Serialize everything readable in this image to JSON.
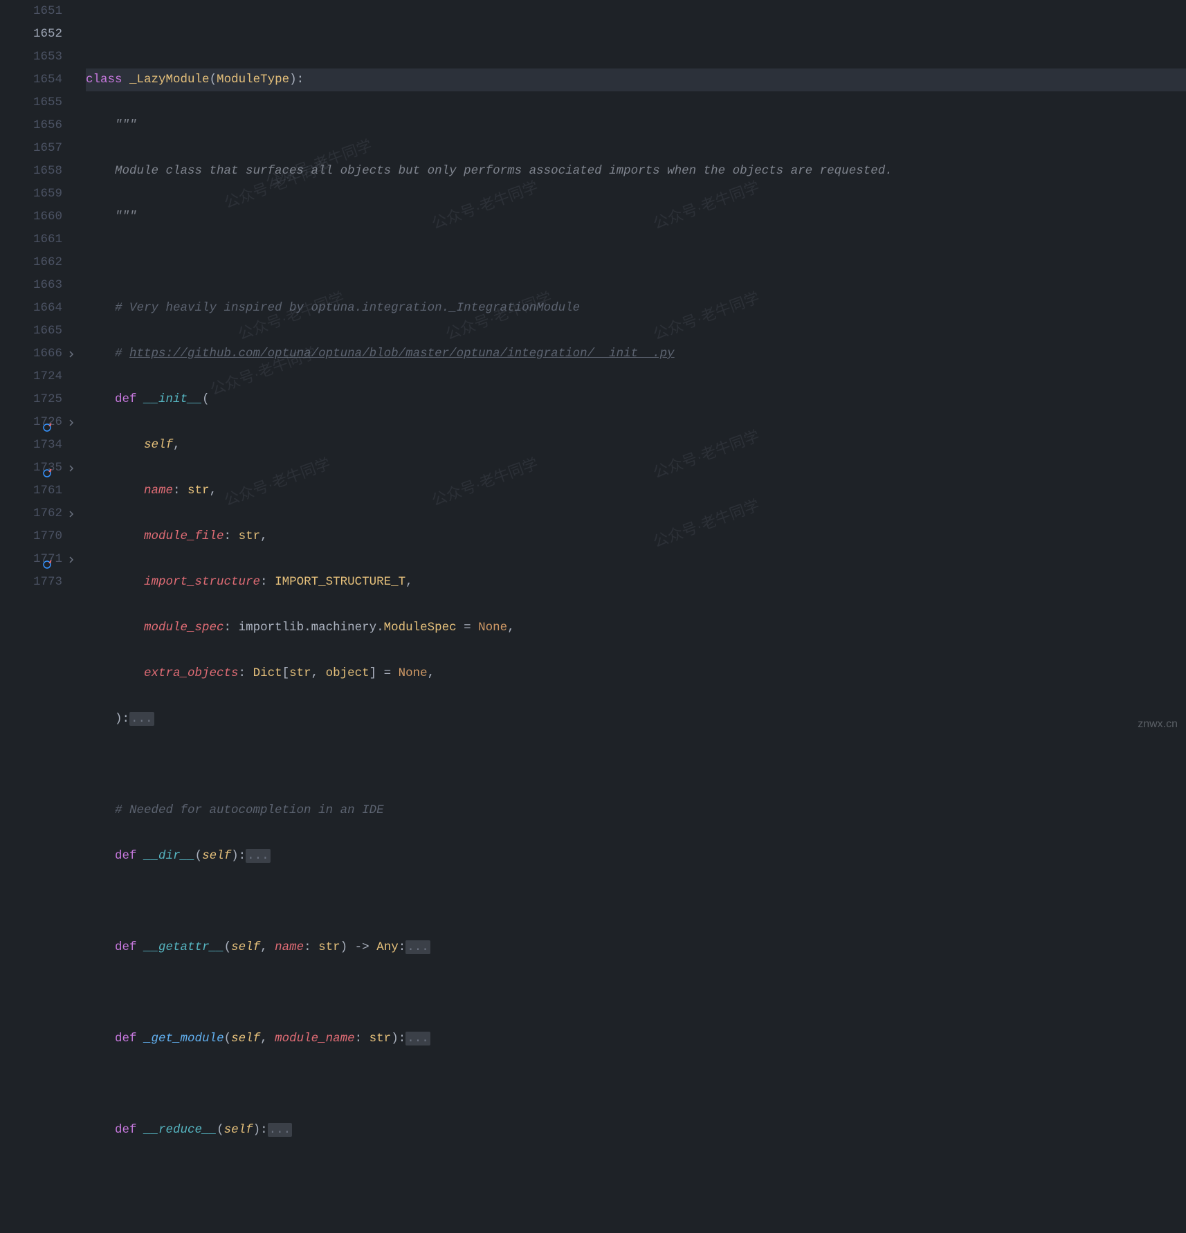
{
  "watermark_text": "公众号·老牛同学",
  "corner": "znwx.cn",
  "fold_marker": "...",
  "gutter": [
    {
      "n": "1651"
    },
    {
      "n": "1652",
      "current": true
    },
    {
      "n": "1653"
    },
    {
      "n": "1654"
    },
    {
      "n": "1655"
    },
    {
      "n": "1656"
    },
    {
      "n": "1657"
    },
    {
      "n": "1658"
    },
    {
      "n": "1659"
    },
    {
      "n": "1660"
    },
    {
      "n": "1661"
    },
    {
      "n": "1662"
    },
    {
      "n": "1663"
    },
    {
      "n": "1664"
    },
    {
      "n": "1665"
    },
    {
      "n": "1666",
      "fold": true
    },
    {
      "n": "1724"
    },
    {
      "n": "1725"
    },
    {
      "n": "1726",
      "fold": true,
      "override": true
    },
    {
      "n": "1734"
    },
    {
      "n": "1735",
      "fold": true,
      "override": true
    },
    {
      "n": "1761"
    },
    {
      "n": "1762",
      "fold": true
    },
    {
      "n": "1770"
    },
    {
      "n": "1771",
      "fold": true,
      "override": true
    },
    {
      "n": "1773"
    }
  ],
  "code": {
    "l1652": {
      "kw": "class",
      "name": "_LazyModule",
      "base": "ModuleType"
    },
    "l1653": {
      "doc": "\"\"\""
    },
    "l1654": {
      "doc": "Module class that surfaces all objects but only performs associated imports when the objects are requested."
    },
    "l1655": {
      "doc": "\"\"\""
    },
    "l1657": {
      "c": "# Very heavily inspired by optuna.integration._IntegrationModule"
    },
    "l1658": {
      "c_prefix": "# ",
      "link": "https://github.com/optuna/optuna/blob/master/optuna/integration/__init__.py"
    },
    "l1659": {
      "kw": "def",
      "fn": "__init__"
    },
    "l1660": {
      "p": "self"
    },
    "l1661": {
      "p": "name",
      "t": "str"
    },
    "l1662": {
      "p": "module_file",
      "t": "str"
    },
    "l1663": {
      "p": "import_structure",
      "t": "IMPORT_STRUCTURE_T"
    },
    "l1664": {
      "p": "module_spec",
      "t_mod": "importlib.machinery",
      "t_cls": "ModuleSpec",
      "d": "None"
    },
    "l1665": {
      "p": "extra_objects",
      "t_outer": "Dict",
      "t_inner1": "str",
      "t_inner2": "object",
      "d": "None"
    },
    "l1725": {
      "c": "# Needed for autocompletion in an IDE"
    },
    "l1726": {
      "kw": "def",
      "fn": "__dir__",
      "params": "self"
    },
    "l1735": {
      "kw": "def",
      "fn": "__getattr__",
      "p_self": "self",
      "p2": "name",
      "p2t": "str",
      "ret": "Any"
    },
    "l1762": {
      "kw": "def",
      "fn": "_get_module",
      "p_self": "self",
      "p2": "module_name",
      "p2t": "str"
    },
    "l1771": {
      "kw": "def",
      "fn": "__reduce__",
      "params": "self"
    }
  }
}
